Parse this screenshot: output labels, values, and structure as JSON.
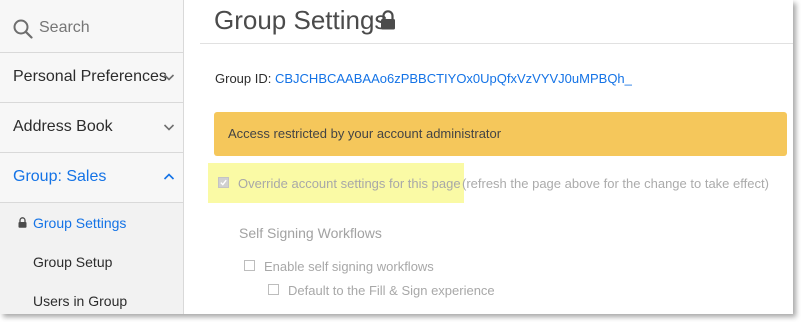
{
  "sidebar": {
    "search": {
      "placeholder": "Search"
    },
    "items": [
      {
        "label": "Personal Preferences"
      },
      {
        "label": "Address Book"
      },
      {
        "label": "Group: Sales"
      }
    ],
    "subitems": [
      {
        "label": "Group Settings"
      },
      {
        "label": "Group Setup"
      },
      {
        "label": "Users in Group"
      }
    ]
  },
  "main": {
    "title": "Group Settings",
    "group_id_label": "Group ID:",
    "group_id_value": "CBJCHBCAABAAo6zPBBCTIYOx0UpQfxVzVYVJ0uMPBQh_",
    "alert_text": "Access restricted by your account administrator",
    "override_label": "Override account settings for this page",
    "override_note": "(refresh the page above for the change to take effect)",
    "section_title": "Self Signing Workflows",
    "options": [
      {
        "label": "Enable self signing workflows"
      },
      {
        "label": "Default to the Fill & Sign experience"
      }
    ]
  },
  "colors": {
    "accent": "#1473e6",
    "alert_bg": "#f5c75b",
    "highlight": "#fafaa5",
    "sidebar_bg": "#f2f2f2"
  },
  "icons": [
    "search-icon",
    "chevron-down-icon",
    "chevron-up-icon",
    "lock-icon",
    "checkbox-icon"
  ]
}
